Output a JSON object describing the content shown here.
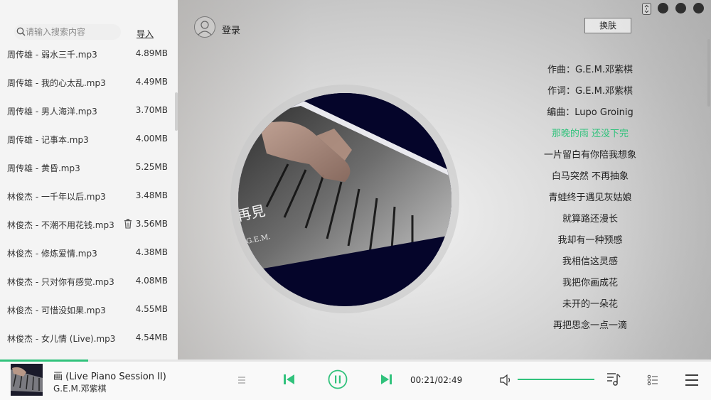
{
  "sidebar": {
    "search_placeholder": "请输入搜索内容",
    "import_label": "导入",
    "songs": [
      {
        "name": "周传雄 - 弱水三千.mp3",
        "size": "4.89MB"
      },
      {
        "name": "周传雄 - 我的心太乱.mp3",
        "size": "4.49MB"
      },
      {
        "name": "周传雄 - 男人海洋.mp3",
        "size": "3.70MB"
      },
      {
        "name": "周传雄 - 记事本.mp3",
        "size": "4.00MB"
      },
      {
        "name": "周传雄 - 黄昏.mp3",
        "size": "5.25MB"
      },
      {
        "name": "林俊杰 - 一千年以后.mp3",
        "size": "3.48MB"
      },
      {
        "name": "林俊杰 - 不潮不用花钱.mp3",
        "size": "3.56MB"
      },
      {
        "name": "林俊杰 - 修炼爱情.mp3",
        "size": "4.38MB"
      },
      {
        "name": "林俊杰 - 只对你有感觉.mp3",
        "size": "4.08MB"
      },
      {
        "name": "林俊杰 - 可惜没如果.mp3",
        "size": "4.55MB"
      },
      {
        "name": "林俊杰 - 女儿情 (Live).mp3",
        "size": "4.54MB"
      }
    ]
  },
  "header": {
    "login_label": "登录",
    "skin_label": "换肤"
  },
  "lyrics": {
    "active_index": 3,
    "lines": [
      "作曲：G.E.M.邓紫棋",
      "作词：G.E.M.邓紫棋",
      "编曲：Lupo Groinig",
      "那晚的雨 还没下完",
      "一片留白有你陪我想象",
      "白马突然 不再抽象",
      "青蛙终于遇见灰姑娘",
      "就算路还漫长",
      "我却有一种预感",
      "我相信这灵感",
      "我把你画成花",
      "未开的一朵花",
      "再把思念一点一滴"
    ]
  },
  "player": {
    "title": "画 (Live Piano Session II)",
    "artist": "G.E.M.邓紫棋",
    "time": "00:21/02:49",
    "progress": 0.124,
    "volume": 1.0,
    "accent_color": "#31c27c"
  },
  "disc": {
    "cover_text": "再見",
    "cover_sub": "G.E.M."
  }
}
